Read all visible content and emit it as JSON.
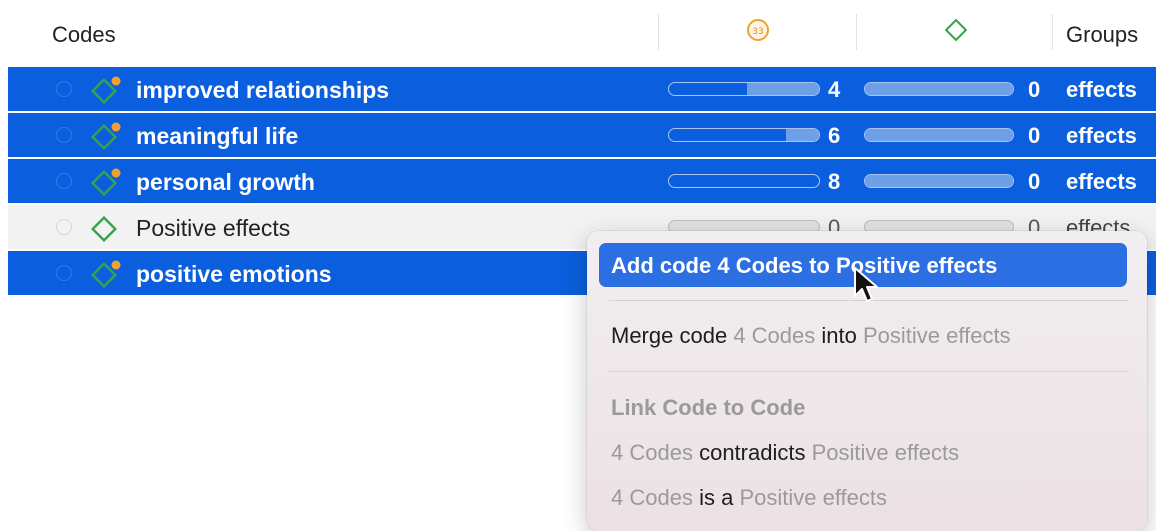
{
  "header": {
    "codes_column": "Codes",
    "groundedness_icon": "quote-count-icon",
    "density_icon": "code-link-diamond-icon",
    "groups_column": "Groups"
  },
  "colors": {
    "selection_blue": "#0b5fde",
    "menu_highlight": "#2b6fe2",
    "code_icon_green": "#36a24b",
    "badge_orange": "#f0a230"
  },
  "rows": [
    {
      "label": "improved relationships",
      "groundedness": "4",
      "groundedness_level": 0.52,
      "density": "0",
      "density_level": 1.0,
      "group": "effects",
      "selected": true,
      "icon": "code-diamond-with-dot-icon"
    },
    {
      "label": "meaningful life",
      "groundedness": "6",
      "groundedness_level": 0.22,
      "density": "0",
      "density_level": 1.0,
      "group": "effects",
      "selected": true,
      "icon": "code-diamond-with-dot-icon"
    },
    {
      "label": "personal growth",
      "groundedness": "8",
      "groundedness_level": 0.0,
      "density": "0",
      "density_level": 1.0,
      "group": "effects",
      "selected": true,
      "icon": "code-diamond-with-dot-icon"
    },
    {
      "label": "Positive effects",
      "groundedness": "0",
      "groundedness_level": 0.0,
      "density": "0",
      "density_level": 0.0,
      "group": "effects",
      "selected": false,
      "icon": "code-diamond-icon"
    },
    {
      "label": "positive emotions",
      "selected": true,
      "icon": "code-diamond-with-dot-icon"
    }
  ],
  "menu": {
    "add": {
      "prefix": "Add code",
      "codes": "4 Codes",
      "connector": "to",
      "target": "Positive effects"
    },
    "merge": {
      "prefix": "Merge code",
      "codes": "4 Codes",
      "connector": "into",
      "target": "Positive effects"
    },
    "link_title": "Link Code to Code",
    "relations": [
      {
        "codes": "4 Codes",
        "relation": "contradicts",
        "target": "Positive effects"
      },
      {
        "codes": "4 Codes",
        "relation": "is a",
        "target": "Positive effects"
      }
    ]
  }
}
